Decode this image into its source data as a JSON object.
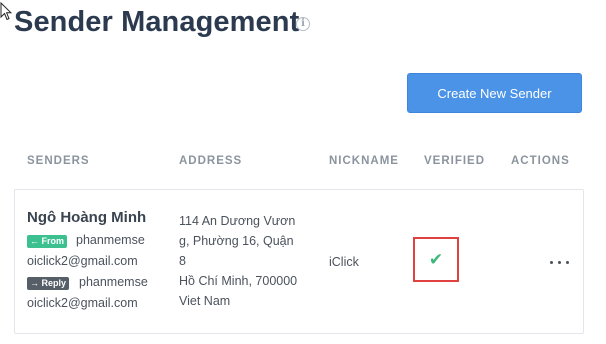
{
  "page": {
    "title": "Sender Management",
    "info_icon": "info-icon"
  },
  "toolbar": {
    "create_label": "Create New Sender"
  },
  "table": {
    "headers": [
      "SENDERS",
      "ADDRESS",
      "NICKNAME",
      "VERIFIED",
      "ACTIONS"
    ],
    "rows": [
      {
        "name": "Ngô Hoàng Minh",
        "from_badge": "← From",
        "from_email_line1": "phanmemse",
        "from_email_line2": "oiclick2@gmail.com",
        "reply_badge": "→ Reply",
        "reply_email_line1": "phanmemse",
        "reply_email_line2": "oiclick2@gmail.com",
        "address_lines": [
          "114 An Dương Vươn",
          "g, Phường 16, Quận",
          "8",
          "Hồ Chí Minh, 700000",
          "Viet Nam"
        ],
        "nickname": "iClick",
        "verified_icon": "check-icon",
        "verified_glyph": "✔",
        "actions_icon": "more-dots-icon"
      }
    ]
  },
  "colors": {
    "primary_button": "#4a93e7",
    "from_badge": "#3cc08f",
    "reply_badge": "#565e67",
    "verified_check": "#3cb87a",
    "highlight_box": "#e0433f"
  }
}
